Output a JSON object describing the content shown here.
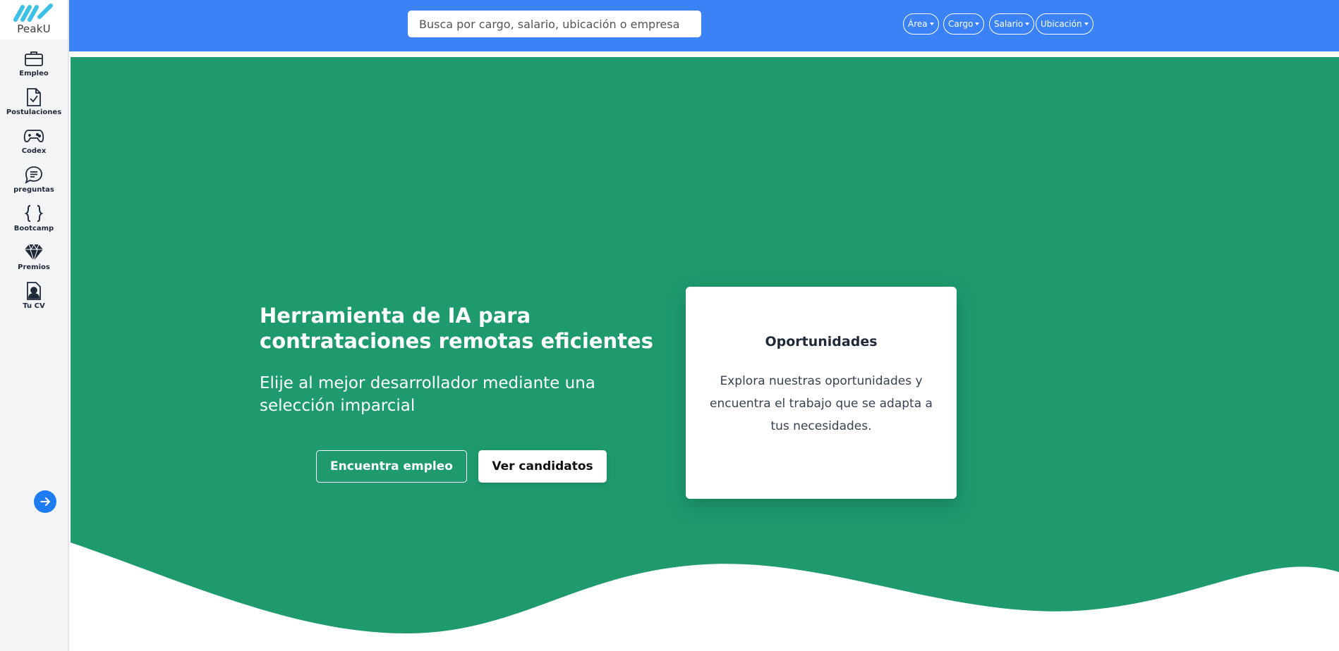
{
  "brand": {
    "name": "PeakU"
  },
  "sidebar": {
    "items": [
      {
        "label": "Empleo",
        "icon": "briefcase-icon"
      },
      {
        "label": "Postulaciones",
        "icon": "file-check-icon"
      },
      {
        "label": "Codex",
        "icon": "gamepad-icon"
      },
      {
        "label": "preguntas",
        "icon": "chat-icon"
      },
      {
        "label": "Bootcamp",
        "icon": "braces-icon"
      },
      {
        "label": "Premios",
        "icon": "diamond-icon"
      },
      {
        "label": "Tu CV",
        "icon": "cv-person-icon"
      }
    ],
    "expand_icon": "arrow-right-icon"
  },
  "header": {
    "search_placeholder": "Busca por cargo, salario, ubicación o empresa",
    "filters": [
      "Área",
      "Cargo",
      "Salario",
      "Ubicación"
    ]
  },
  "hero": {
    "title": "Herramienta de IA para contrataciones remotas eficientes",
    "subtitle": "Elije al mejor desarrollador mediante una selección imparcial",
    "primary_button": "Encuentra empleo",
    "secondary_button": "Ver candidatos"
  },
  "card": {
    "title": "Oportunidades",
    "text": "Explora nuestras oportunidades y encuentra el trabajo que se adapta a tus necesidades."
  },
  "colors": {
    "topbar": "#3b82f6",
    "hero": "#1e9a6d",
    "expand_button": "#1d7cf2",
    "logo": "#3ec1e6"
  }
}
